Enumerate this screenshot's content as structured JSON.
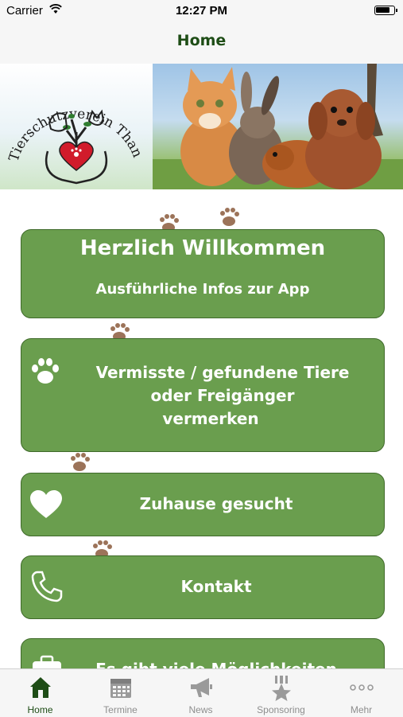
{
  "status_bar": {
    "carrier": "Carrier",
    "time": "12:27 PM",
    "battery_level": 0.85
  },
  "nav": {
    "title": "Home"
  },
  "banner": {
    "logo_text": "Tierschutzverein Thannhausen e.V."
  },
  "menu": {
    "welcome": {
      "title": "Herzlich Willkommen",
      "subtitle": "Ausführliche Infos zur App"
    },
    "lost_found": {
      "line1": "Vermisste / gefundene Tiere",
      "line2": "oder Freigänger",
      "line3": "vermerken",
      "icon": "paw-icon"
    },
    "home_wanted": {
      "label": "Zuhause gesucht",
      "icon": "heart-icon"
    },
    "contact": {
      "label": "Kontakt",
      "icon": "phone-icon"
    },
    "more_options": {
      "label": "Es gibt viele Möglichkeiten",
      "icon": "briefcase-icon"
    }
  },
  "tabs": [
    {
      "label": "Home",
      "icon": "house-icon",
      "active": true
    },
    {
      "label": "Termine",
      "icon": "calendar-icon",
      "active": false
    },
    {
      "label": "News",
      "icon": "megaphone-icon",
      "active": false
    },
    {
      "label": "Sponsoring",
      "icon": "medal-star-icon",
      "active": false
    },
    {
      "label": "Mehr",
      "icon": "more-dots-icon",
      "active": false
    }
  ],
  "colors": {
    "accent": "#6a9e4e",
    "accent_border": "#3f6a2a",
    "title_green": "#1e4d16",
    "paw": "#8b5a3c",
    "heart": "#d11b2b"
  }
}
